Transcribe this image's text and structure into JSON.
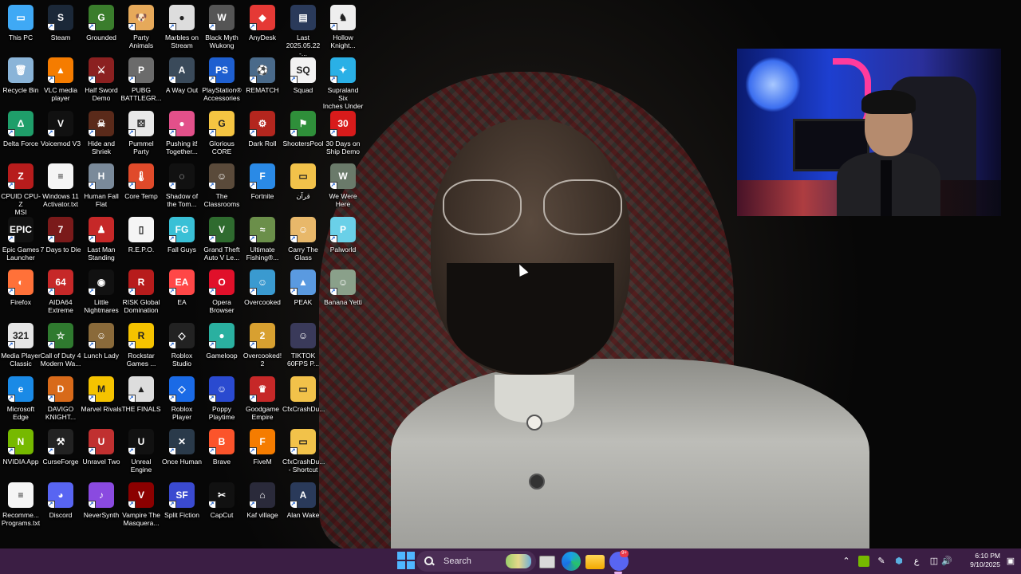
{
  "desktop": {
    "icons": [
      {
        "label": "This PC",
        "color": "#3fa9f5",
        "glyph": "▭",
        "shortcut": false
      },
      {
        "label": "Steam",
        "color": "#1b2838",
        "glyph": "S",
        "shortcut": true
      },
      {
        "label": "Grounded",
        "color": "#3a7d2c",
        "glyph": "G",
        "shortcut": true
      },
      {
        "label": "Party\nAnimals",
        "color": "#e6a95a",
        "glyph": "🐶",
        "shortcut": true
      },
      {
        "label": "Marbles on\nStream",
        "color": "#dddddd",
        "glyph": "●",
        "shortcut": true
      },
      {
        "label": "Black Myth\nWukong",
        "color": "#555555",
        "glyph": "W",
        "shortcut": true
      },
      {
        "label": "AnyDesk",
        "color": "#e53935",
        "glyph": "◆",
        "shortcut": true
      },
      {
        "label": "Last\n2025.05.22 -...",
        "color": "#2a3a5a",
        "glyph": "▤",
        "shortcut": false
      },
      {
        "label": "Hollow\nKnight...",
        "color": "#eeeeee",
        "glyph": "♞",
        "shortcut": true
      },
      {
        "label": "Recycle Bin",
        "color": "#8ab4d8",
        "glyph": "🗑",
        "shortcut": false
      },
      {
        "label": "VLC media\nplayer",
        "color": "#f57c00",
        "glyph": "▲",
        "shortcut": true
      },
      {
        "label": "Half Sword\nDemo",
        "color": "#8b2020",
        "glyph": "⚔",
        "shortcut": true
      },
      {
        "label": "PUBG\nBATTLEGR...",
        "color": "#6b6b6b",
        "glyph": "P",
        "shortcut": true
      },
      {
        "label": "A Way Out",
        "color": "#3a4a5a",
        "glyph": "A",
        "shortcut": true
      },
      {
        "label": "PlayStation®\nAccessories",
        "color": "#1e5fd0",
        "glyph": "PS",
        "shortcut": true
      },
      {
        "label": "REMATCH",
        "color": "#4a6a8a",
        "glyph": "⚽",
        "shortcut": true
      },
      {
        "label": "Squad",
        "color": "#f2f2f2",
        "glyph": "SQ",
        "shortcut": true
      },
      {
        "label": "Supraland Six\nInches Under",
        "color": "#2ab0e6",
        "glyph": "✦",
        "shortcut": true
      },
      {
        "label": "Delta Force",
        "color": "#1f9e6a",
        "glyph": "Δ",
        "shortcut": true
      },
      {
        "label": "Voicemod V3",
        "color": "#111111",
        "glyph": "V",
        "shortcut": true
      },
      {
        "label": "Hide and\nShriek",
        "color": "#5a2a1a",
        "glyph": "☠",
        "shortcut": true
      },
      {
        "label": "Pummel\nParty",
        "color": "#e8e8e8",
        "glyph": "⚄",
        "shortcut": true
      },
      {
        "label": "Pushing it!\nTogether...",
        "color": "#e2508a",
        "glyph": "●",
        "shortcut": true
      },
      {
        "label": "Glorious\nCORE",
        "color": "#f5c542",
        "glyph": "G",
        "shortcut": true
      },
      {
        "label": "Dark Roll",
        "color": "#b3261e",
        "glyph": "⚙",
        "shortcut": true
      },
      {
        "label": "ShootersPool",
        "color": "#2f8f3a",
        "glyph": "⚑",
        "shortcut": true
      },
      {
        "label": "30 Days on\nShip Demo",
        "color": "#d81b1b",
        "glyph": "30",
        "shortcut": true
      },
      {
        "label": "CPUID CPU-Z\nMSI",
        "color": "#b71c1c",
        "glyph": "Z",
        "shortcut": true
      },
      {
        "label": "Windows 11\nActivator.txt",
        "color": "#f5f5f5",
        "glyph": "≡",
        "shortcut": false
      },
      {
        "label": "Human Fall\nFlat",
        "color": "#7a8a9a",
        "glyph": "H",
        "shortcut": true
      },
      {
        "label": "Core Temp",
        "color": "#e04a2a",
        "glyph": "🌡",
        "shortcut": true
      },
      {
        "label": "Shadow of\nthe Tom...",
        "color": "#111111",
        "glyph": "◌",
        "shortcut": true
      },
      {
        "label": "The\nClassrooms",
        "color": "#5a4a3a",
        "glyph": "☺",
        "shortcut": true
      },
      {
        "label": "Fortnite",
        "color": "#2a8ae6",
        "glyph": "F",
        "shortcut": true
      },
      {
        "label": "قرآن",
        "color": "#f2c24a",
        "glyph": "▭",
        "shortcut": false
      },
      {
        "label": "We Were\nHere",
        "color": "#6a7a6a",
        "glyph": "W",
        "shortcut": true
      },
      {
        "label": "Epic Games\nLauncher",
        "color": "#111111",
        "glyph": "EPIC",
        "shortcut": true
      },
      {
        "label": "7 Days to Die",
        "color": "#7a1a1a",
        "glyph": "7",
        "shortcut": true
      },
      {
        "label": "Last Man\nStanding",
        "color": "#c62828",
        "glyph": "♟",
        "shortcut": true
      },
      {
        "label": "R.E.P.O.",
        "color": "#f5f5f5",
        "glyph": "▯",
        "shortcut": false
      },
      {
        "label": "Fall Guys",
        "color": "#39c0d6",
        "glyph": "FG",
        "shortcut": true
      },
      {
        "label": "Grand Theft\nAuto V Le...",
        "color": "#2f6b2f",
        "glyph": "V",
        "shortcut": true
      },
      {
        "label": "Ultimate\nFishing®...",
        "color": "#6b8f4a",
        "glyph": "≈",
        "shortcut": true
      },
      {
        "label": "Carry The\nGlass",
        "color": "#e8b86a",
        "glyph": "☺",
        "shortcut": true
      },
      {
        "label": "Palworld",
        "color": "#6ad0e8",
        "glyph": "P",
        "shortcut": true
      },
      {
        "label": "Firefox",
        "color": "#ff7139",
        "glyph": "◐",
        "shortcut": true
      },
      {
        "label": "AIDA64\nExtreme",
        "color": "#c62828",
        "glyph": "64",
        "shortcut": true
      },
      {
        "label": "Little\nNightmares",
        "color": "#111111",
        "glyph": "◉",
        "shortcut": true
      },
      {
        "label": "RISK Global\nDomination",
        "color": "#b71c1c",
        "glyph": "R",
        "shortcut": true
      },
      {
        "label": "EA",
        "color": "#ff4747",
        "glyph": "EA",
        "shortcut": true
      },
      {
        "label": "Opera\nBrowser",
        "color": "#e0102a",
        "glyph": "O",
        "shortcut": true
      },
      {
        "label": "Overcooked",
        "color": "#3a9ad0",
        "glyph": "☺",
        "shortcut": true
      },
      {
        "label": "PEAK",
        "color": "#5a9ae0",
        "glyph": "▲",
        "shortcut": true
      },
      {
        "label": "Banana Yetti",
        "color": "#8aa08a",
        "glyph": "☺",
        "shortcut": true
      },
      {
        "label": "Media Player\nClassic",
        "color": "#e6e6e6",
        "glyph": "321",
        "shortcut": true
      },
      {
        "label": "Call of Duty 4\nModern Wa...",
        "color": "#2f7a2f",
        "glyph": "☆",
        "shortcut": true
      },
      {
        "label": "Lunch Lady",
        "color": "#8a6a3a",
        "glyph": "☺",
        "shortcut": true
      },
      {
        "label": "Rockstar\nGames ...",
        "color": "#f5c300",
        "glyph": "R",
        "shortcut": true
      },
      {
        "label": "Roblox\nStudio",
        "color": "#222222",
        "glyph": "◇",
        "shortcut": true
      },
      {
        "label": "Gameloop",
        "color": "#2ab0a0",
        "glyph": "●",
        "shortcut": true
      },
      {
        "label": "Overcooked!\n2",
        "color": "#d8a030",
        "glyph": "2",
        "shortcut": true
      },
      {
        "label": "TIKTOK\n60FPS P...",
        "color": "#3a3a5a",
        "glyph": "☺",
        "shortcut": false
      },
      {
        "label": "Microsoft\nEdge",
        "color": "#1a8ae6",
        "glyph": "e",
        "shortcut": true
      },
      {
        "label": "DAVIGO\nKNIGHT...",
        "color": "#d86a1a",
        "glyph": "D",
        "shortcut": true
      },
      {
        "label": "Marvel Rivals",
        "color": "#f5c300",
        "glyph": "M",
        "shortcut": true
      },
      {
        "label": "THE FINALS",
        "color": "#dddddd",
        "glyph": "▲",
        "shortcut": true
      },
      {
        "label": "Roblox Player",
        "color": "#1a6ae6",
        "glyph": "◇",
        "shortcut": true
      },
      {
        "label": "Poppy\nPlaytime",
        "color": "#2a4ad0",
        "glyph": "☺",
        "shortcut": true
      },
      {
        "label": "Goodgame\nEmpire",
        "color": "#c62828",
        "glyph": "♛",
        "shortcut": true
      },
      {
        "label": "CfxCrashDu...",
        "color": "#f2c24a",
        "glyph": "▭",
        "shortcut": false
      },
      {
        "label": "NVIDIA App",
        "color": "#76b900",
        "glyph": "N",
        "shortcut": true
      },
      {
        "label": "CurseForge",
        "color": "#222222",
        "glyph": "⚒",
        "shortcut": true
      },
      {
        "label": "Unravel Two",
        "color": "#c03030",
        "glyph": "U",
        "shortcut": true
      },
      {
        "label": "Unreal\nEngine",
        "color": "#111111",
        "glyph": "U",
        "shortcut": true
      },
      {
        "label": "Once Human",
        "color": "#2a3a4a",
        "glyph": "✕",
        "shortcut": true
      },
      {
        "label": "Brave",
        "color": "#fb542b",
        "glyph": "B",
        "shortcut": true
      },
      {
        "label": "FiveM",
        "color": "#f57c00",
        "glyph": "F",
        "shortcut": true
      },
      {
        "label": "CfxCrashDu...\n- Shortcut",
        "color": "#f2c24a",
        "glyph": "▭",
        "shortcut": true
      },
      {
        "label": "Recomme...\nPrograms.txt",
        "color": "#f5f5f5",
        "glyph": "≡",
        "shortcut": false
      },
      {
        "label": "Discord",
        "color": "#5865f2",
        "glyph": "◕",
        "shortcut": true
      },
      {
        "label": "NeverSynth",
        "color": "#8a4ae0",
        "glyph": "♪",
        "shortcut": true
      },
      {
        "label": "Vampire The\nMasquera...",
        "color": "#8b0000",
        "glyph": "V",
        "shortcut": true
      },
      {
        "label": "Split Fiction",
        "color": "#3a4ad0",
        "glyph": "SF",
        "shortcut": true
      },
      {
        "label": "CapCut",
        "color": "#111111",
        "glyph": "✂",
        "shortcut": true
      },
      {
        "label": "Kaf village",
        "color": "#2a2a3a",
        "glyph": "⌂",
        "shortcut": true
      },
      {
        "label": "Alan Wake",
        "color": "#2a3a5a",
        "glyph": "A",
        "shortcut": true
      }
    ]
  },
  "taskbar": {
    "search_label": "Search",
    "notification_badge": "9+",
    "tray_lang": "ع",
    "time": "6:10 PM",
    "date": "9/10/2025"
  }
}
